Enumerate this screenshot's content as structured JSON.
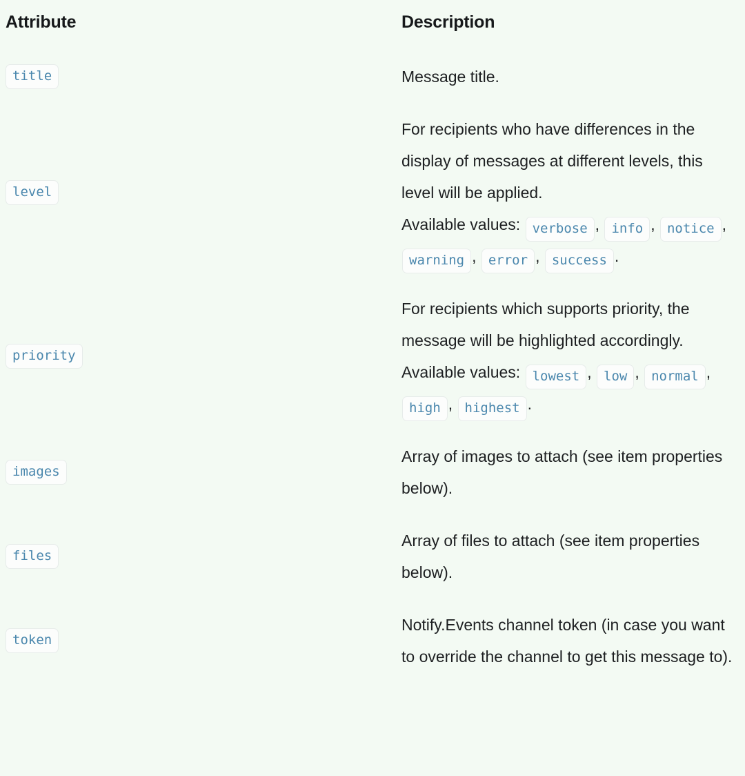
{
  "table": {
    "headers": {
      "attribute": "Attribute",
      "description": "Description"
    },
    "rows": [
      {
        "attribute": "title",
        "description_lines": [
          "Message title."
        ],
        "values_prefix": null,
        "values": [],
        "values_suffix": null
      },
      {
        "attribute": "level",
        "description_lines": [
          "For recipients who have differences in the display of messages at different levels, this level will be applied."
        ],
        "values_prefix": "Available values:",
        "values": [
          "verbose",
          "info",
          "notice",
          "warning",
          "error",
          "success"
        ],
        "values_suffix": "."
      },
      {
        "attribute": "priority",
        "description_lines": [
          "For recipients which supports priority, the message will be highlighted accordingly."
        ],
        "values_prefix": "Available values:",
        "values": [
          "lowest",
          "low",
          "normal",
          "high",
          "highest"
        ],
        "values_suffix": "."
      },
      {
        "attribute": "images",
        "description_lines": [
          "Array of images to attach (see item properties below)."
        ],
        "values_prefix": null,
        "values": [],
        "values_suffix": null
      },
      {
        "attribute": "files",
        "description_lines": [
          "Array of files to attach (see item properties below)."
        ],
        "values_prefix": null,
        "values": [],
        "values_suffix": null
      },
      {
        "attribute": "token",
        "description_lines": [
          "Notify.Events channel token (in case you want to override the channel to get this message to)."
        ],
        "values_prefix": null,
        "values": [],
        "values_suffix": null
      }
    ]
  },
  "colors": {
    "page_background": "#f3faf3",
    "code_text": "#4a87ad",
    "code_background": "#fcfdfc",
    "code_border": "#e7ecea",
    "body_text": "#1d1f21"
  }
}
